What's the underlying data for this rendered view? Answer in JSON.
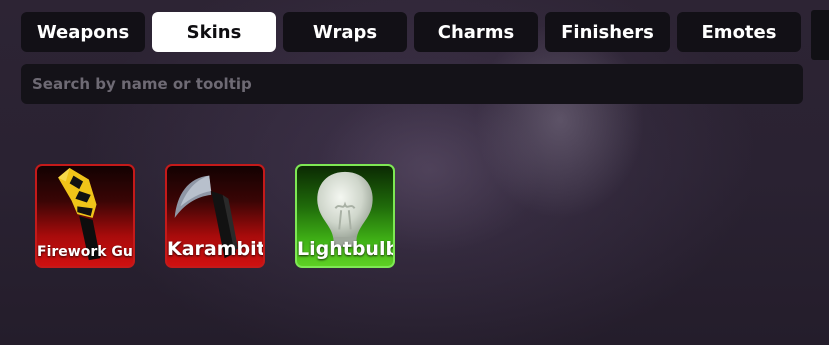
{
  "tabs": [
    {
      "label": "Weapons",
      "active": false
    },
    {
      "label": "Skins",
      "active": true
    },
    {
      "label": "Wraps",
      "active": false
    },
    {
      "label": "Charms",
      "active": false
    },
    {
      "label": "Finishers",
      "active": false
    },
    {
      "label": "Emotes",
      "active": false
    }
  ],
  "search": {
    "placeholder": "Search by name or tooltip",
    "value": ""
  },
  "items": [
    {
      "name": "Firework Gun",
      "rarity_color": "#c41a1a",
      "icon": "firework-gun-icon"
    },
    {
      "name": "Karambit",
      "rarity_color": "#c41a1a",
      "icon": "karambit-icon"
    },
    {
      "name": "Lightbulb",
      "rarity_color": "#7ee854",
      "icon": "lightbulb-icon"
    }
  ],
  "colors": {
    "tab_background": "#121016",
    "tab_active_background": "#ffffff",
    "red_rarity": "#c41a1a",
    "green_rarity": "#7ee854"
  }
}
